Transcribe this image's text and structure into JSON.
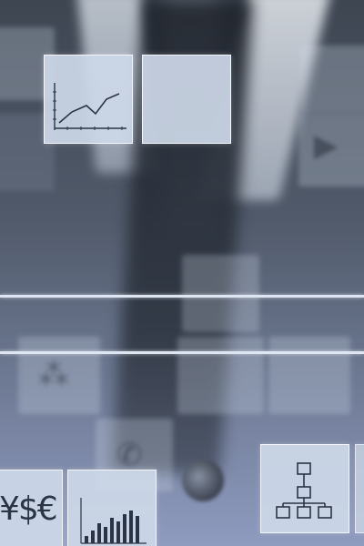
{
  "scene": {
    "description_tiles": [
      {
        "name": "line-chart-icon"
      },
      {
        "name": "blank-tile"
      },
      {
        "name": "currency-icon",
        "text": "¥$€"
      },
      {
        "name": "bar-chart-icon"
      },
      {
        "name": "org-chart-icon"
      }
    ],
    "colors": {
      "tile": "#cdd8e8",
      "line": "#dfe6f3",
      "icon_stroke": "#2b3444"
    }
  },
  "currency_text": "¥$€"
}
